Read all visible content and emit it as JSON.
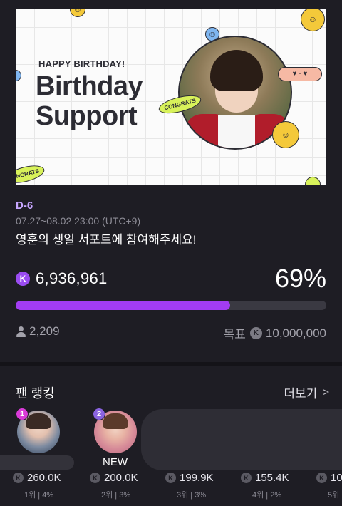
{
  "banner": {
    "kicker": "HAPPY BIRTHDAY!",
    "headline": "Birthday Support",
    "sticker_main": "CONGRATS",
    "sticker_corner": "ONGRATS",
    "heart_tag": "♥ - ♥"
  },
  "campaign": {
    "dday": "D-6",
    "period": "07.27~08.02 23:00 (UTC+9)",
    "description": "영훈의 생일 서포트에 참여해주세요!",
    "coin_symbol": "K",
    "amount": "6,936,961",
    "percent": "69%",
    "progress_fraction": 0.69,
    "supporters": "2,209",
    "goal_label": "목표",
    "goal_amount": "10,000,000",
    "colors": {
      "accent": "#a23cf3",
      "dday": "#c7a6ff"
    }
  },
  "ranking": {
    "title": "팬 랭킹",
    "more_label": "더보기",
    "more_icon": "chevron-right-icon",
    "top": [
      {
        "rank": "1"
      },
      {
        "rank": "2",
        "tag": "NEW"
      }
    ],
    "entries": [
      {
        "value": "260.0K",
        "meta": "1위 | 4%"
      },
      {
        "value": "200.0K",
        "meta": "2위 | 3%"
      },
      {
        "value": "199.9K",
        "meta": "3위 | 3%"
      },
      {
        "value": "155.4K",
        "meta": "4위 | 2%"
      },
      {
        "value": "10",
        "meta": "5위"
      }
    ]
  }
}
